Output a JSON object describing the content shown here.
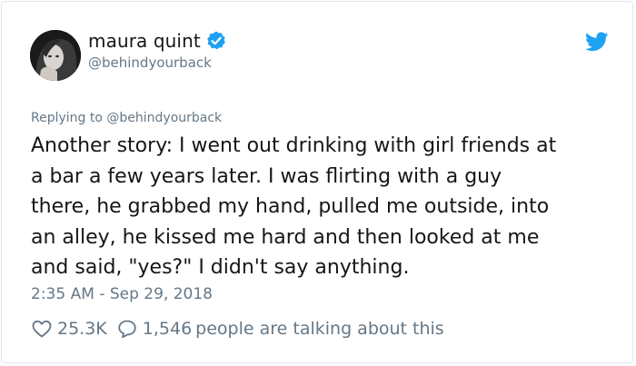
{
  "author": {
    "display_name": "maura quint",
    "handle": "@behindyourback",
    "verified_icon": "verified-badge-icon",
    "avatar_icon": "profile-avatar"
  },
  "brand": {
    "icon": "twitter-bird-icon",
    "color": "#1da1f2"
  },
  "tweet": {
    "replying_to_prefix": "Replying to ",
    "replying_to_handle": "@behindyourback",
    "text": "Another story: I went out drinking with girl friends at\na bar a few years later. I was flirting with a guy\nthere, he grabbed my hand, pulled me outside, into\nan alley, he kissed me hard and then looked at me\nand said, \"yes?\" I didn't say anything.",
    "timestamp": "2:35 AM - Sep 29, 2018"
  },
  "actions": {
    "likes": "25.3K",
    "like_icon": "heart-icon",
    "reply_icon": "speech-bubble-icon",
    "talking_count": "1,546",
    "talking_label": "people are talking about this"
  },
  "colors": {
    "text": "#14171a",
    "secondary": "#657786",
    "border": "#e1e8ed",
    "verified": "#1da1f2"
  }
}
